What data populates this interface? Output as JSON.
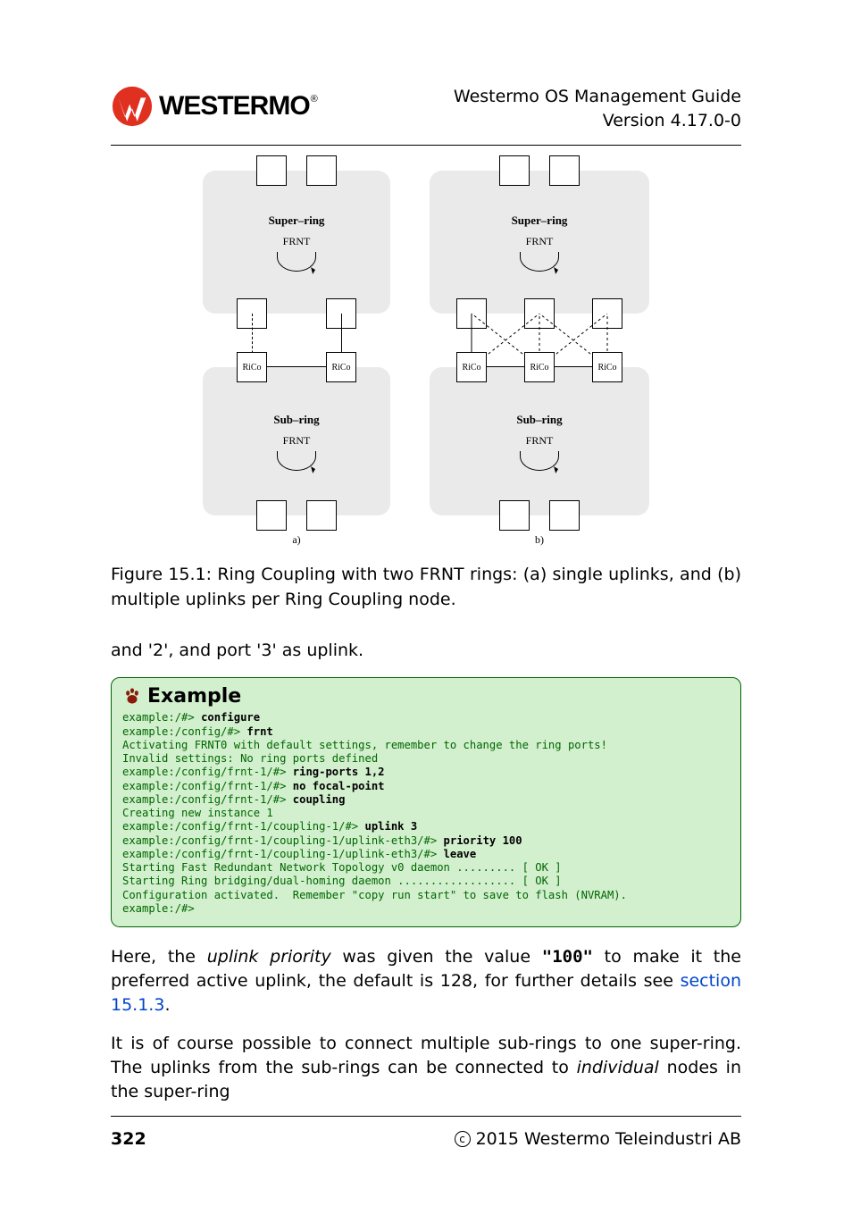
{
  "header": {
    "brand": "WESTERMO",
    "title_line1": "Westermo OS Management Guide",
    "title_line2": "Version 4.17.0-0"
  },
  "figure": {
    "super_ring_label": "Super–ring",
    "sub_ring_label": "Sub–ring",
    "frnt_label": "FRNT",
    "rico_label": "RiCo",
    "subcaption_a": "a)",
    "subcaption_b": "b)",
    "caption": "Figure 15.1: Ring Coupling with two FRNT rings: (a) single uplinks, and (b) multiple uplinks per Ring Coupling node."
  },
  "body": {
    "intro_line": "and '2', and port '3' as uplink.",
    "after1_pre": "Here, the ",
    "after1_em": "uplink priority",
    "after1_mid": " was given the value ",
    "after1_val": "\"100\"",
    "after1_post": " to make it the preferred active uplink, the default is 128, for further details see ",
    "after1_link": "section 15.1.3",
    "after1_end": ".",
    "after2_pre": "It is of course possible to connect multiple sub-rings to one super-ring. The uplinks from the sub-rings can be connected to ",
    "after2_em": "individual",
    "after2_post": " nodes in the super-ring"
  },
  "example": {
    "title": "Example",
    "lines": [
      {
        "prompt": "example:/#> ",
        "cmd": "configure",
        "out": ""
      },
      {
        "prompt": "example:/config/#> ",
        "cmd": "frnt",
        "out": ""
      },
      {
        "prompt": "",
        "cmd": "",
        "out": "Activating FRNT0 with default settings, remember to change the ring ports!"
      },
      {
        "prompt": "",
        "cmd": "",
        "out": "Invalid settings: No ring ports defined"
      },
      {
        "prompt": "example:/config/frnt-1/#> ",
        "cmd": "ring-ports 1,2",
        "out": ""
      },
      {
        "prompt": "example:/config/frnt-1/#> ",
        "cmd": "no focal-point",
        "out": ""
      },
      {
        "prompt": "example:/config/frnt-1/#> ",
        "cmd": "coupling",
        "out": ""
      },
      {
        "prompt": "",
        "cmd": "",
        "out": "Creating new instance 1"
      },
      {
        "prompt": "example:/config/frnt-1/coupling-1/#> ",
        "cmd": "uplink 3",
        "out": ""
      },
      {
        "prompt": "example:/config/frnt-1/coupling-1/uplink-eth3/#> ",
        "cmd": "priority 100",
        "out": ""
      },
      {
        "prompt": "example:/config/frnt-1/coupling-1/uplink-eth3/#> ",
        "cmd": "leave",
        "out": ""
      },
      {
        "prompt": "",
        "cmd": "",
        "out": "Starting Fast Redundant Network Topology v0 daemon ......... [ OK ]"
      },
      {
        "prompt": "",
        "cmd": "",
        "out": "Starting Ring bridging/dual-homing daemon .................. [ OK ]"
      },
      {
        "prompt": "",
        "cmd": "",
        "out": "Configuration activated.  Remember \"copy run start\" to save to flash (NVRAM)."
      },
      {
        "prompt": "example:/#>",
        "cmd": "",
        "out": ""
      }
    ]
  },
  "footer": {
    "page": "322",
    "copyright": "2015 Westermo Teleindustri AB"
  },
  "chart_data": [
    {
      "type": "diagram",
      "title": "Ring Coupling (a) — single uplinks",
      "rings": [
        {
          "name": "Super-ring",
          "protocol": "FRNT",
          "top_ports": 2,
          "bottom_nodes": 2
        },
        {
          "name": "Sub-ring",
          "protocol": "FRNT",
          "top_nodes": [
            {
              "label": "RiCo"
            },
            {
              "label": "RiCo"
            }
          ],
          "bottom_ports": 2
        }
      ],
      "uplinks": [
        {
          "from": "Sub-ring.RiCo[0]",
          "to": "Super-ring.bottom[0]",
          "style": "dashed"
        },
        {
          "from": "Sub-ring.RiCo[1]",
          "to": "Super-ring.bottom[1]",
          "style": "solid"
        }
      ]
    },
    {
      "type": "diagram",
      "title": "Ring Coupling (b) — multiple uplinks per node",
      "rings": [
        {
          "name": "Super-ring",
          "protocol": "FRNT",
          "top_ports": 2,
          "bottom_nodes": 3
        },
        {
          "name": "Sub-ring",
          "protocol": "FRNT",
          "top_nodes": [
            {
              "label": "RiCo"
            },
            {
              "label": "RiCo"
            },
            {
              "label": "RiCo"
            }
          ],
          "bottom_ports": 2
        }
      ],
      "uplinks": [
        {
          "from": "Sub-ring.RiCo[0]",
          "to": "Super-ring.bottom[0]",
          "style": "solid"
        },
        {
          "from": "Sub-ring.RiCo[0]",
          "to": "Super-ring.bottom[1]",
          "style": "dashed"
        },
        {
          "from": "Sub-ring.RiCo[1]",
          "to": "Super-ring.bottom[0]",
          "style": "dashed"
        },
        {
          "from": "Sub-ring.RiCo[1]",
          "to": "Super-ring.bottom[1]",
          "style": "dashed"
        },
        {
          "from": "Sub-ring.RiCo[1]",
          "to": "Super-ring.bottom[2]",
          "style": "dashed"
        },
        {
          "from": "Sub-ring.RiCo[2]",
          "to": "Super-ring.bottom[1]",
          "style": "dashed"
        },
        {
          "from": "Sub-ring.RiCo[2]",
          "to": "Super-ring.bottom[2]",
          "style": "dashed"
        }
      ]
    }
  ]
}
